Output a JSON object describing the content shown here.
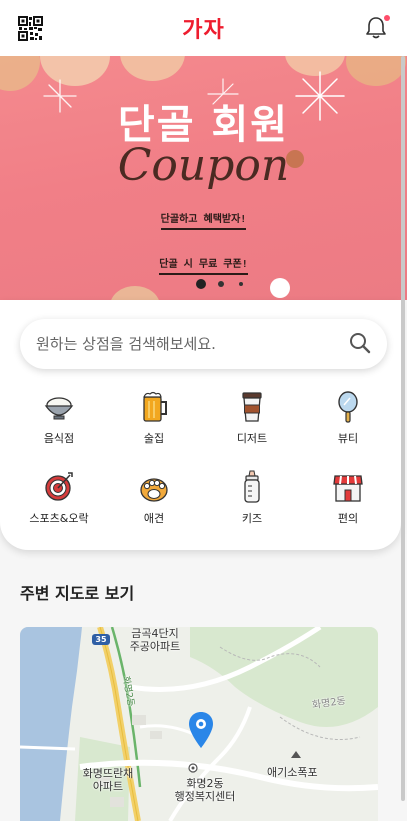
{
  "header": {
    "logo_text": "가자",
    "qr_icon": "qr-code-icon",
    "bell_icon": "bell-icon",
    "notification_badge_color": "#ff4d6a"
  },
  "banner": {
    "title": "단골 회원",
    "coupon_script": "Coupon",
    "line1": "단골하고 혜택받자!",
    "line2": "단골 시 무료 쿠폰!",
    "background": "#f17f87",
    "slide_indicator": {
      "slides": 3,
      "active": 1
    }
  },
  "search": {
    "placeholder": "원하는 상점을 검색해보세요.",
    "value": "",
    "icon": "search-icon"
  },
  "categories": [
    {
      "label": "음식점",
      "icon": "rice-bowl-icon"
    },
    {
      "label": "술집",
      "icon": "beer-mug-icon"
    },
    {
      "label": "디저트",
      "icon": "coffee-cup-icon"
    },
    {
      "label": "뷰티",
      "icon": "hand-mirror-icon"
    },
    {
      "label": "스포츠&오락",
      "icon": "dartboard-icon"
    },
    {
      "label": "애견",
      "icon": "paw-icon"
    },
    {
      "label": "키즈",
      "icon": "baby-bottle-icon"
    },
    {
      "label": "편의",
      "icon": "convenience-store-icon"
    }
  ],
  "map_section": {
    "title": "주변 지도로 보기",
    "labels": {
      "apt1": "금곡4단지\n주공아파트",
      "road": "화명2동",
      "apt2": "화명뜨란채\n아파트",
      "center": "화명2동\n행정복지센터",
      "waterfall": "애기소폭포",
      "route": "35",
      "area": "화명2동"
    }
  },
  "colors": {
    "brand_red": "#ee1c2e",
    "map_pin": "#2a86e8"
  }
}
